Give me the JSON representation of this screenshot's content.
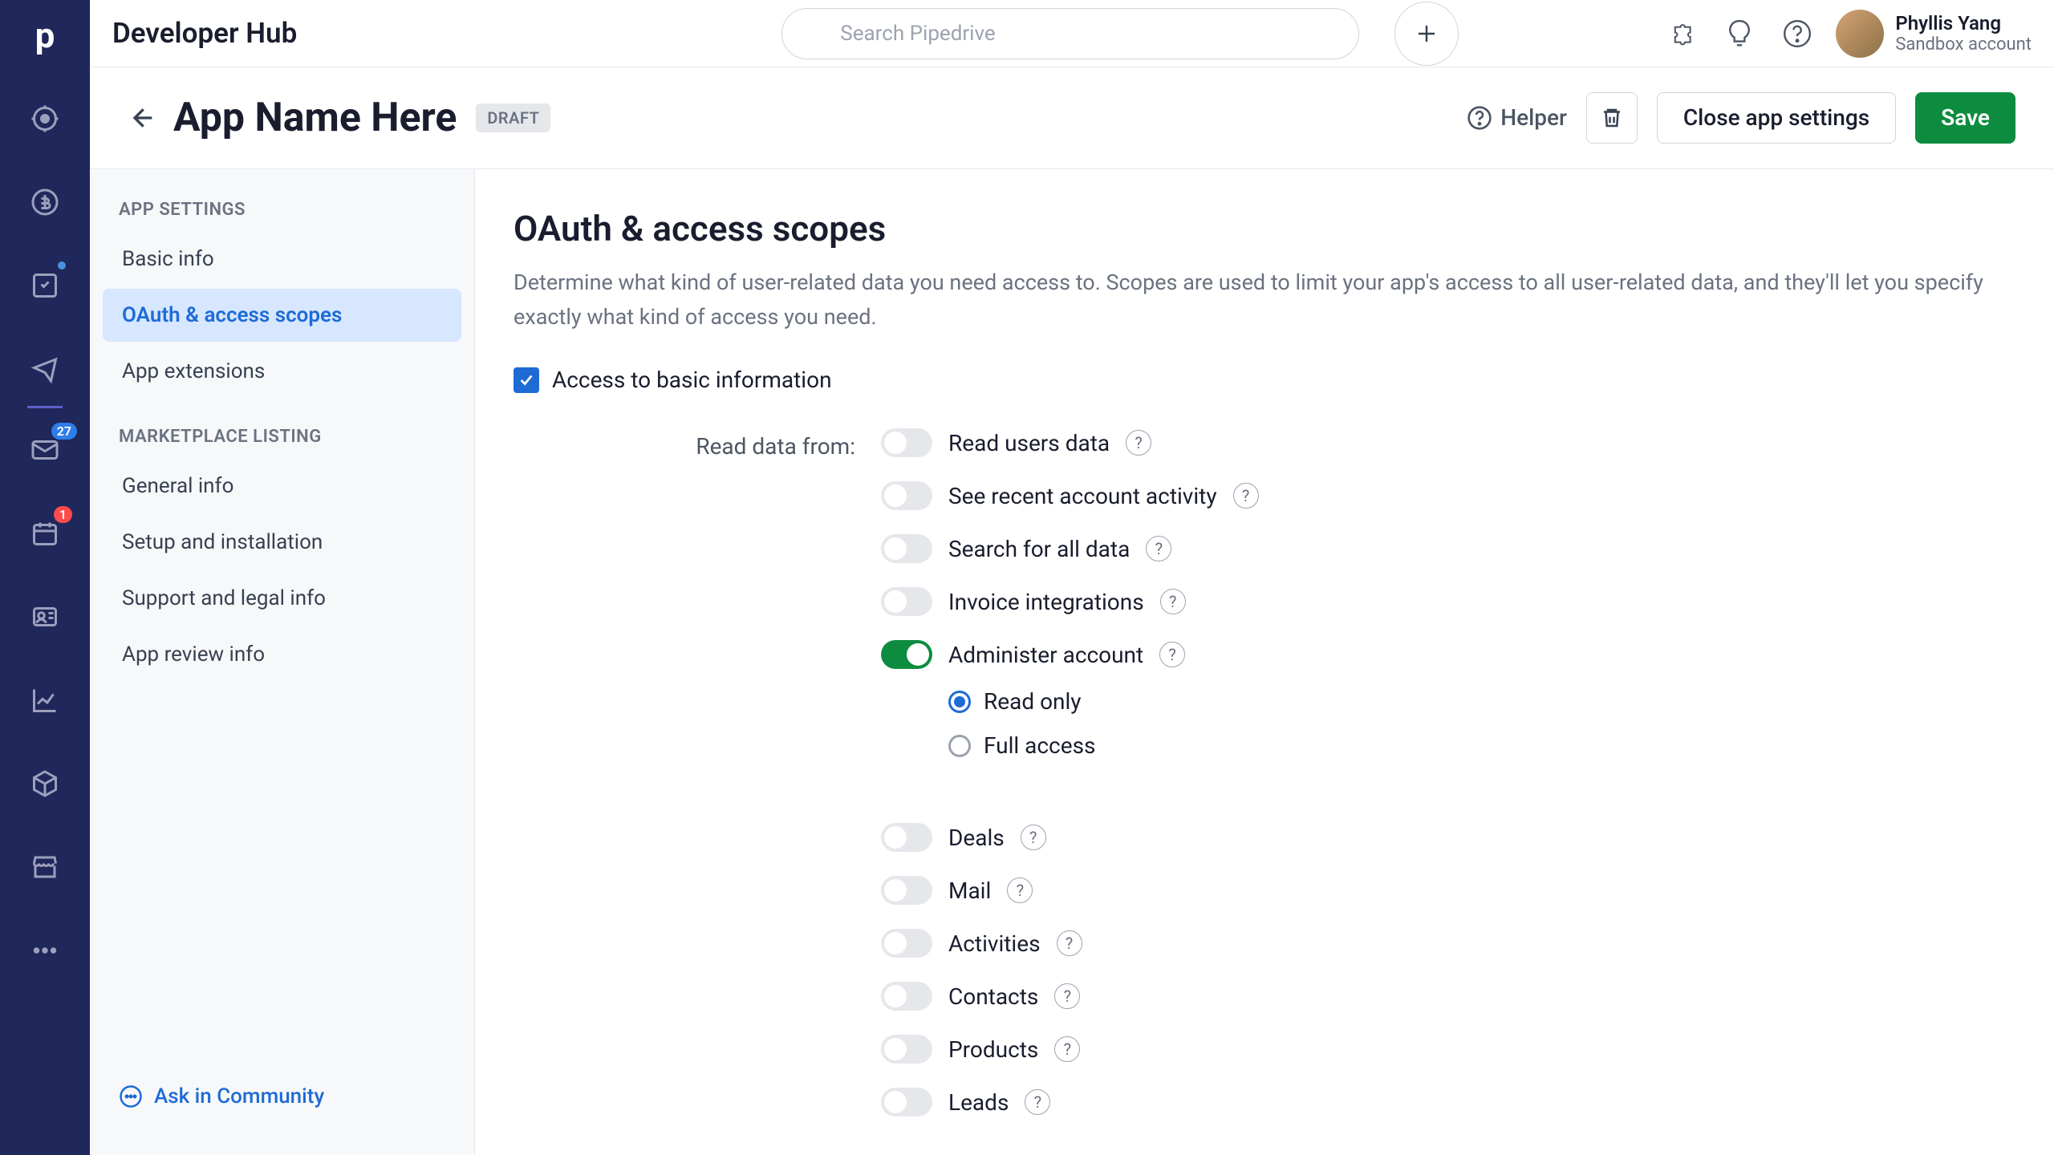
{
  "topbar": {
    "title": "Developer Hub",
    "search_placeholder": "Search Pipedrive",
    "user_name": "Phyllis Yang",
    "user_account": "Sandbox account"
  },
  "nav_rail": {
    "mail_badge": "27",
    "calendar_badge": "1"
  },
  "page_header": {
    "title": "App Name Here",
    "badge": "DRAFT",
    "helper": "Helper",
    "close": "Close app settings",
    "save": "Save"
  },
  "sidebar": {
    "section1": "APP SETTINGS",
    "items1": [
      "Basic info",
      "OAuth & access scopes",
      "App extensions"
    ],
    "section2": "MARKETPLACE LISTING",
    "items2": [
      "General info",
      "Setup and installation",
      "Support and legal info",
      "App review info"
    ],
    "ask_community": "Ask in Community"
  },
  "content": {
    "title": "OAuth & access scopes",
    "description": "Determine what kind of user-related data you need access to. Scopes are used to limit your app's access to all user-related data, and they'll let you specify exactly what kind of access you need.",
    "access_basic": "Access to basic information",
    "read_data_label": "Read data from:",
    "scopes_group1": [
      {
        "name": "Read users data",
        "on": false
      },
      {
        "name": "See recent account activity",
        "on": false
      },
      {
        "name": "Search for all data",
        "on": false
      },
      {
        "name": "Invoice integrations",
        "on": false
      },
      {
        "name": "Administer account",
        "on": true
      }
    ],
    "admin_options": [
      "Read only",
      "Full access"
    ],
    "admin_selected": "Read only",
    "scopes_group2": [
      {
        "name": "Deals",
        "on": false
      },
      {
        "name": "Mail",
        "on": false
      },
      {
        "name": "Activities",
        "on": false
      },
      {
        "name": "Contacts",
        "on": false
      },
      {
        "name": "Products",
        "on": false
      },
      {
        "name": "Leads",
        "on": false
      }
    ]
  }
}
